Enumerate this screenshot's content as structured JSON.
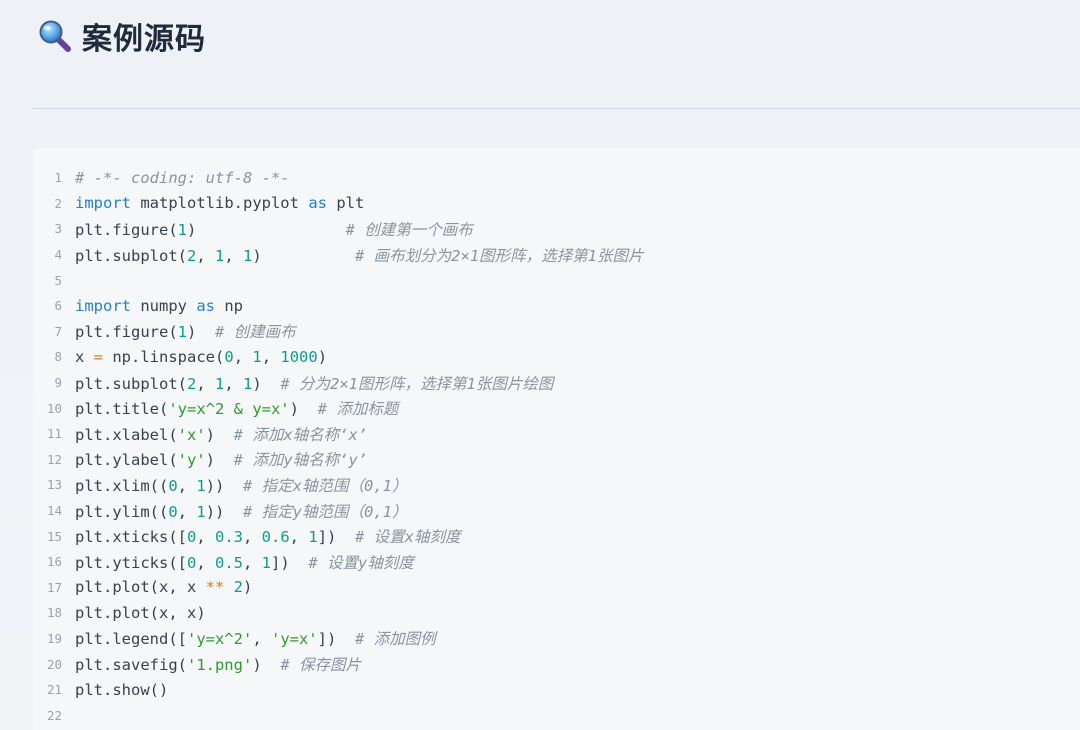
{
  "header": {
    "icon": "search-icon",
    "title": "案例源码"
  },
  "colors": {
    "keyword": "#1f7fd6",
    "number": "#0e9d8c",
    "string": "#2e9b2e",
    "operator": "#e07a1f",
    "comment": "#8a94a0",
    "text": "#38424f"
  },
  "code": {
    "lines": [
      {
        "n": "1",
        "tokens": [
          {
            "t": "cmt",
            "v": "# -*- coding: utf-8 -*-"
          }
        ]
      },
      {
        "n": "2",
        "tokens": [
          {
            "t": "kw",
            "v": "import"
          },
          {
            "t": "plain",
            "v": " matplotlib.pyplot "
          },
          {
            "t": "kw",
            "v": "as"
          },
          {
            "t": "plain",
            "v": " plt"
          }
        ]
      },
      {
        "n": "3",
        "tokens": [
          {
            "t": "plain",
            "v": "plt.figure("
          },
          {
            "t": "num",
            "v": "1"
          },
          {
            "t": "plain",
            "v": ")                "
          },
          {
            "t": "cmt",
            "v": "# 创建第一个画布"
          }
        ]
      },
      {
        "n": "4",
        "tokens": [
          {
            "t": "plain",
            "v": "plt.subplot("
          },
          {
            "t": "num",
            "v": "2"
          },
          {
            "t": "plain",
            "v": ", "
          },
          {
            "t": "num",
            "v": "1"
          },
          {
            "t": "plain",
            "v": ", "
          },
          {
            "t": "num",
            "v": "1"
          },
          {
            "t": "plain",
            "v": ")          "
          },
          {
            "t": "cmt",
            "v": "# 画布划分为2×1图形阵，选择第1张图片"
          }
        ]
      },
      {
        "n": "5",
        "tokens": []
      },
      {
        "n": "6",
        "tokens": [
          {
            "t": "kw",
            "v": "import"
          },
          {
            "t": "plain",
            "v": " numpy "
          },
          {
            "t": "kw",
            "v": "as"
          },
          {
            "t": "plain",
            "v": " np"
          }
        ]
      },
      {
        "n": "7",
        "tokens": [
          {
            "t": "plain",
            "v": "plt.figure("
          },
          {
            "t": "num",
            "v": "1"
          },
          {
            "t": "plain",
            "v": ")  "
          },
          {
            "t": "cmt",
            "v": "# 创建画布"
          }
        ]
      },
      {
        "n": "8",
        "tokens": [
          {
            "t": "plain",
            "v": "x "
          },
          {
            "t": "op",
            "v": "="
          },
          {
            "t": "plain",
            "v": " np.linspace("
          },
          {
            "t": "num",
            "v": "0"
          },
          {
            "t": "plain",
            "v": ", "
          },
          {
            "t": "num",
            "v": "1"
          },
          {
            "t": "plain",
            "v": ", "
          },
          {
            "t": "num",
            "v": "1000"
          },
          {
            "t": "plain",
            "v": ")"
          }
        ]
      },
      {
        "n": "9",
        "tokens": [
          {
            "t": "plain",
            "v": "plt.subplot("
          },
          {
            "t": "num",
            "v": "2"
          },
          {
            "t": "plain",
            "v": ", "
          },
          {
            "t": "num",
            "v": "1"
          },
          {
            "t": "plain",
            "v": ", "
          },
          {
            "t": "num",
            "v": "1"
          },
          {
            "t": "plain",
            "v": ")  "
          },
          {
            "t": "cmt",
            "v": "# 分为2×1图形阵，选择第1张图片绘图"
          }
        ]
      },
      {
        "n": "10",
        "tokens": [
          {
            "t": "plain",
            "v": "plt.title("
          },
          {
            "t": "str",
            "v": "'y=x^2 & y=x'"
          },
          {
            "t": "plain",
            "v": ")  "
          },
          {
            "t": "cmt",
            "v": "# 添加标题"
          }
        ]
      },
      {
        "n": "11",
        "tokens": [
          {
            "t": "plain",
            "v": "plt.xlabel("
          },
          {
            "t": "str",
            "v": "'x'"
          },
          {
            "t": "plain",
            "v": ")  "
          },
          {
            "t": "cmt",
            "v": "# 添加x轴名称‘x’"
          }
        ]
      },
      {
        "n": "12",
        "tokens": [
          {
            "t": "plain",
            "v": "plt.ylabel("
          },
          {
            "t": "str",
            "v": "'y'"
          },
          {
            "t": "plain",
            "v": ")  "
          },
          {
            "t": "cmt",
            "v": "# 添加y轴名称‘y’"
          }
        ]
      },
      {
        "n": "13",
        "tokens": [
          {
            "t": "plain",
            "v": "plt.xlim(("
          },
          {
            "t": "num",
            "v": "0"
          },
          {
            "t": "plain",
            "v": ", "
          },
          {
            "t": "num",
            "v": "1"
          },
          {
            "t": "plain",
            "v": "))  "
          },
          {
            "t": "cmt",
            "v": "# 指定x轴范围（0,1）"
          }
        ]
      },
      {
        "n": "14",
        "tokens": [
          {
            "t": "plain",
            "v": "plt.ylim(("
          },
          {
            "t": "num",
            "v": "0"
          },
          {
            "t": "plain",
            "v": ", "
          },
          {
            "t": "num",
            "v": "1"
          },
          {
            "t": "plain",
            "v": "))  "
          },
          {
            "t": "cmt",
            "v": "# 指定y轴范围（0,1）"
          }
        ]
      },
      {
        "n": "15",
        "tokens": [
          {
            "t": "plain",
            "v": "plt.xticks(["
          },
          {
            "t": "num",
            "v": "0"
          },
          {
            "t": "plain",
            "v": ", "
          },
          {
            "t": "num",
            "v": "0.3"
          },
          {
            "t": "plain",
            "v": ", "
          },
          {
            "t": "num",
            "v": "0.6"
          },
          {
            "t": "plain",
            "v": ", "
          },
          {
            "t": "num",
            "v": "1"
          },
          {
            "t": "plain",
            "v": "])  "
          },
          {
            "t": "cmt",
            "v": "# 设置x轴刻度"
          }
        ]
      },
      {
        "n": "16",
        "tokens": [
          {
            "t": "plain",
            "v": "plt.yticks(["
          },
          {
            "t": "num",
            "v": "0"
          },
          {
            "t": "plain",
            "v": ", "
          },
          {
            "t": "num",
            "v": "0.5"
          },
          {
            "t": "plain",
            "v": ", "
          },
          {
            "t": "num",
            "v": "1"
          },
          {
            "t": "plain",
            "v": "])  "
          },
          {
            "t": "cmt",
            "v": "# 设置y轴刻度"
          }
        ]
      },
      {
        "n": "17",
        "tokens": [
          {
            "t": "plain",
            "v": "plt.plot(x, x "
          },
          {
            "t": "op",
            "v": "**"
          },
          {
            "t": "plain",
            "v": " "
          },
          {
            "t": "num",
            "v": "2"
          },
          {
            "t": "plain",
            "v": ")"
          }
        ]
      },
      {
        "n": "18",
        "tokens": [
          {
            "t": "plain",
            "v": "plt.plot(x, x)"
          }
        ]
      },
      {
        "n": "19",
        "tokens": [
          {
            "t": "plain",
            "v": "plt.legend(["
          },
          {
            "t": "str",
            "v": "'y=x^2'"
          },
          {
            "t": "plain",
            "v": ", "
          },
          {
            "t": "str",
            "v": "'y=x'"
          },
          {
            "t": "plain",
            "v": "])  "
          },
          {
            "t": "cmt",
            "v": "# 添加图例"
          }
        ]
      },
      {
        "n": "20",
        "tokens": [
          {
            "t": "plain",
            "v": "plt.savefig("
          },
          {
            "t": "str",
            "v": "'1.png'"
          },
          {
            "t": "plain",
            "v": ")  "
          },
          {
            "t": "cmt",
            "v": "# 保存图片"
          }
        ]
      },
      {
        "n": "21",
        "tokens": [
          {
            "t": "plain",
            "v": "plt.show()"
          }
        ]
      },
      {
        "n": "22",
        "tokens": []
      }
    ]
  }
}
